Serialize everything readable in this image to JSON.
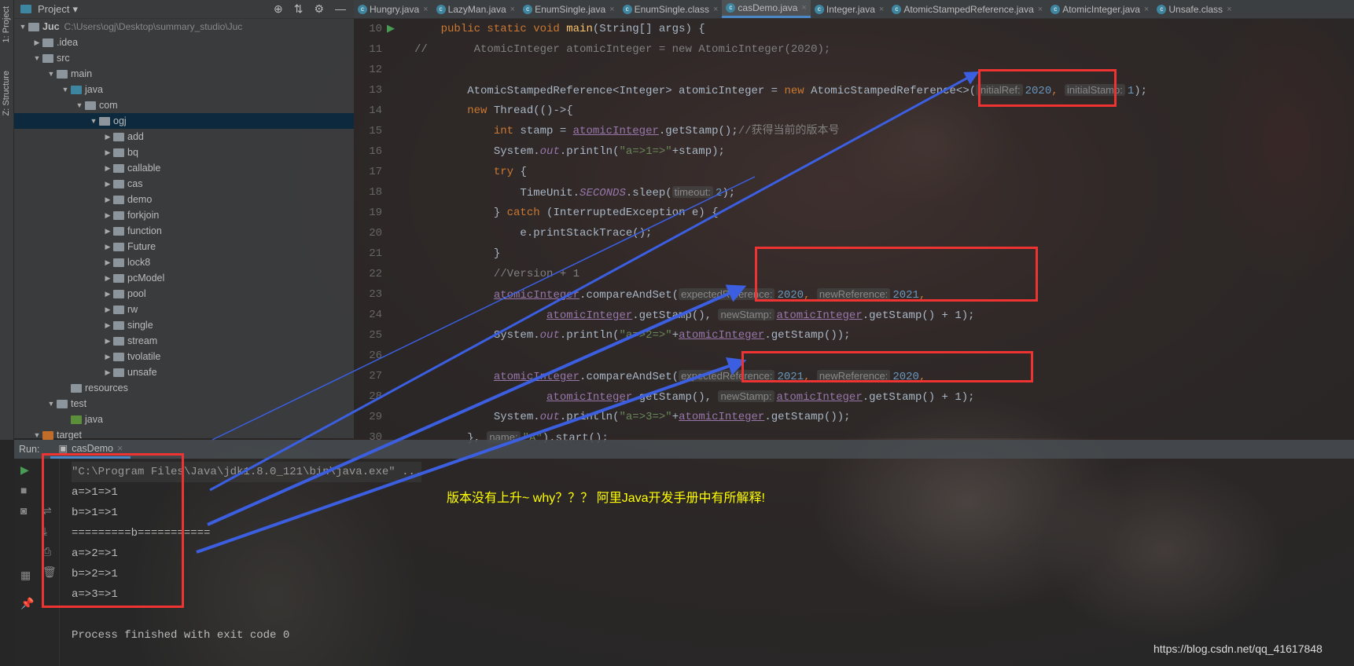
{
  "project": {
    "title": "Project",
    "root": "Juc",
    "root_path": "C:\\Users\\ogj\\Desktop\\summary_studio\\Juc",
    "tree": [
      {
        "label": "Juc",
        "depth": 0,
        "open": true,
        "icon": "module"
      },
      {
        "label": ".idea",
        "depth": 1,
        "open": false,
        "icon": "folder"
      },
      {
        "label": "src",
        "depth": 1,
        "open": true,
        "icon": "folder"
      },
      {
        "label": "main",
        "depth": 2,
        "open": true,
        "icon": "folder"
      },
      {
        "label": "java",
        "depth": 3,
        "open": true,
        "icon": "source-folder"
      },
      {
        "label": "com",
        "depth": 4,
        "open": true,
        "icon": "package"
      },
      {
        "label": "ogj",
        "depth": 5,
        "open": true,
        "icon": "package",
        "selected": true
      },
      {
        "label": "add",
        "depth": 6,
        "open": false,
        "icon": "package"
      },
      {
        "label": "bq",
        "depth": 6,
        "open": false,
        "icon": "package"
      },
      {
        "label": "callable",
        "depth": 6,
        "open": false,
        "icon": "package"
      },
      {
        "label": "cas",
        "depth": 6,
        "open": false,
        "icon": "package"
      },
      {
        "label": "demo",
        "depth": 6,
        "open": false,
        "icon": "package"
      },
      {
        "label": "forkjoin",
        "depth": 6,
        "open": false,
        "icon": "package"
      },
      {
        "label": "function",
        "depth": 6,
        "open": false,
        "icon": "package"
      },
      {
        "label": "Future",
        "depth": 6,
        "open": false,
        "icon": "package"
      },
      {
        "label": "lock8",
        "depth": 6,
        "open": false,
        "icon": "package"
      },
      {
        "label": "pcModel",
        "depth": 6,
        "open": false,
        "icon": "package"
      },
      {
        "label": "pool",
        "depth": 6,
        "open": false,
        "icon": "package"
      },
      {
        "label": "rw",
        "depth": 6,
        "open": false,
        "icon": "package"
      },
      {
        "label": "single",
        "depth": 6,
        "open": false,
        "icon": "package"
      },
      {
        "label": "stream",
        "depth": 6,
        "open": false,
        "icon": "package"
      },
      {
        "label": "tvolatile",
        "depth": 6,
        "open": false,
        "icon": "package"
      },
      {
        "label": "unsafe",
        "depth": 6,
        "open": false,
        "icon": "package"
      },
      {
        "label": "resources",
        "depth": 3,
        "icon": "resources-folder"
      },
      {
        "label": "test",
        "depth": 2,
        "open": true,
        "icon": "folder"
      },
      {
        "label": "java",
        "depth": 3,
        "icon": "test-folder"
      },
      {
        "label": "target",
        "depth": 1,
        "open": true,
        "icon": "excluded-folder"
      }
    ]
  },
  "side_tabs": [
    "1: Project",
    "Z: Structure"
  ],
  "tabs": [
    {
      "label": "Hungry.java"
    },
    {
      "label": "LazyMan.java"
    },
    {
      "label": "EnumSingle.java"
    },
    {
      "label": "EnumSingle.class"
    },
    {
      "label": "casDemo.java",
      "active": true
    },
    {
      "label": "Integer.java"
    },
    {
      "label": "AtomicStampedReference.java"
    },
    {
      "label": "AtomicInteger.java"
    },
    {
      "label": "Unsafe.class"
    }
  ],
  "code": [
    {
      "n": "10",
      "s": [
        [
          "    ",
          ""
        ],
        [
          "public static void ",
          "kw"
        ],
        [
          "main",
          "fn"
        ],
        [
          "(String[] args) {",
          ""
        ]
      ]
    },
    {
      "n": "11",
      "s": [
        [
          "//       AtomicInteger atomicInteger = new AtomicInteger(2020);",
          "cm"
        ]
      ]
    },
    {
      "n": "12",
      "s": []
    },
    {
      "n": "13",
      "s": [
        [
          "        AtomicStampedReference<Integer> atomicInteger = ",
          ""
        ],
        [
          "new ",
          "kw"
        ],
        [
          "AtomicStampedReference<>(",
          ""
        ],
        [
          "initialRef:",
          "hint"
        ],
        [
          "2020",
          "num"
        ],
        [
          ", ",
          "kw"
        ],
        [
          "initialStamp:",
          "hint"
        ],
        [
          "1",
          "num"
        ],
        [
          ");",
          ""
        ]
      ]
    },
    {
      "n": "14",
      "s": [
        [
          "        ",
          ""
        ],
        [
          "new ",
          "kw"
        ],
        [
          "Thread(()->{",
          ""
        ]
      ]
    },
    {
      "n": "15",
      "s": [
        [
          "            ",
          ""
        ],
        [
          "int ",
          "kw"
        ],
        [
          "stamp = ",
          ""
        ],
        [
          "atomicInteger",
          "fld"
        ],
        [
          ".getStamp();",
          ""
        ],
        [
          "//获得当前的版本号",
          "cm"
        ]
      ]
    },
    {
      "n": "16",
      "s": [
        [
          "            System.",
          ""
        ],
        [
          "out",
          "it"
        ],
        [
          ".println(",
          ""
        ],
        [
          "\"a=>1=>\"",
          "str"
        ],
        [
          "+stamp);",
          ""
        ]
      ]
    },
    {
      "n": "17",
      "s": [
        [
          "            ",
          ""
        ],
        [
          "try ",
          "kw"
        ],
        [
          "{",
          ""
        ]
      ]
    },
    {
      "n": "18",
      "s": [
        [
          "                TimeUnit.",
          ""
        ],
        [
          "SECONDS",
          "it"
        ],
        [
          ".sleep(",
          ""
        ],
        [
          "timeout:",
          "hint"
        ],
        [
          "2",
          "num"
        ],
        [
          ");",
          ""
        ]
      ]
    },
    {
      "n": "19",
      "s": [
        [
          "            } ",
          ""
        ],
        [
          "catch ",
          "kw"
        ],
        [
          "(InterruptedException e) {",
          ""
        ]
      ]
    },
    {
      "n": "20",
      "s": [
        [
          "                e.printStackTrace();",
          ""
        ]
      ]
    },
    {
      "n": "21",
      "s": [
        [
          "            }",
          ""
        ]
      ]
    },
    {
      "n": "22",
      "s": [
        [
          "            //Version + 1",
          "cm"
        ]
      ]
    },
    {
      "n": "23",
      "s": [
        [
          "            ",
          ""
        ],
        [
          "atomicInteger",
          "fld"
        ],
        [
          ".compareAndSet(",
          ""
        ],
        [
          "expectedReference:",
          "hint"
        ],
        [
          "2020",
          "num"
        ],
        [
          ", ",
          "kw"
        ],
        [
          "newReference:",
          "hint"
        ],
        [
          "2021",
          "num"
        ],
        [
          ",",
          "kw"
        ]
      ]
    },
    {
      "n": "24",
      "s": [
        [
          "                    ",
          ""
        ],
        [
          "atomicInteger",
          "fld"
        ],
        [
          ".getStamp(), ",
          ""
        ],
        [
          "newStamp:",
          "hint"
        ],
        [
          "atomicInteger",
          "fld"
        ],
        [
          ".getStamp() + 1);",
          ""
        ]
      ]
    },
    {
      "n": "25",
      "s": [
        [
          "            System.",
          ""
        ],
        [
          "out",
          "it"
        ],
        [
          ".println(",
          ""
        ],
        [
          "\"a=>2=>\"",
          "str"
        ],
        [
          "+",
          ""
        ],
        [
          "atomicInteger",
          "fld"
        ],
        [
          ".getStamp());",
          ""
        ]
      ]
    },
    {
      "n": "26",
      "s": []
    },
    {
      "n": "27",
      "s": [
        [
          "            ",
          ""
        ],
        [
          "atomicInteger",
          "fld"
        ],
        [
          ".compareAndSet(",
          ""
        ],
        [
          "expectedReference:",
          "hint"
        ],
        [
          "2021",
          "num"
        ],
        [
          ", ",
          "kw"
        ],
        [
          "newReference:",
          "hint"
        ],
        [
          "2020",
          "num"
        ],
        [
          ",",
          "kw"
        ]
      ]
    },
    {
      "n": "28",
      "s": [
        [
          "                    ",
          ""
        ],
        [
          "atomicInteger",
          "fld"
        ],
        [
          ".getStamp(), ",
          ""
        ],
        [
          "newStamp:",
          "hint"
        ],
        [
          "atomicInteger",
          "fld"
        ],
        [
          ".getStamp() + 1);",
          ""
        ]
      ]
    },
    {
      "n": "29",
      "s": [
        [
          "            System.",
          ""
        ],
        [
          "out",
          "it"
        ],
        [
          ".println(",
          ""
        ],
        [
          "\"a=>3=>\"",
          "str"
        ],
        [
          "+",
          ""
        ],
        [
          "atomicInteger",
          "fld"
        ],
        [
          ".getStamp());",
          ""
        ]
      ]
    },
    {
      "n": "30",
      "s": [
        [
          "        }, ",
          ""
        ],
        [
          "name:",
          "hint"
        ],
        [
          "\"A\"",
          "str"
        ],
        [
          ").start();",
          ""
        ]
      ]
    }
  ],
  "run": {
    "label": "Run:",
    "tab": "casDemo",
    "output": [
      "\"C:\\Program Files\\Java\\jdk1.8.0_121\\bin\\java.exe\" ...",
      "a=>1=>1",
      "b=>1=>1",
      "=========b===========",
      "a=>2=>1",
      "b=>2=>1",
      "a=>3=>1",
      "",
      "Process finished with exit code 0"
    ]
  },
  "annotation": {
    "note": "版本没有上升~ why？？？ 阿里Java开发手册中有所解释!",
    "box_color": "#ee3333",
    "arrow_color": "#3b5fe0",
    "note_color": "#ffff00"
  },
  "watermark": "https://blog.csdn.net/qq_41617848"
}
